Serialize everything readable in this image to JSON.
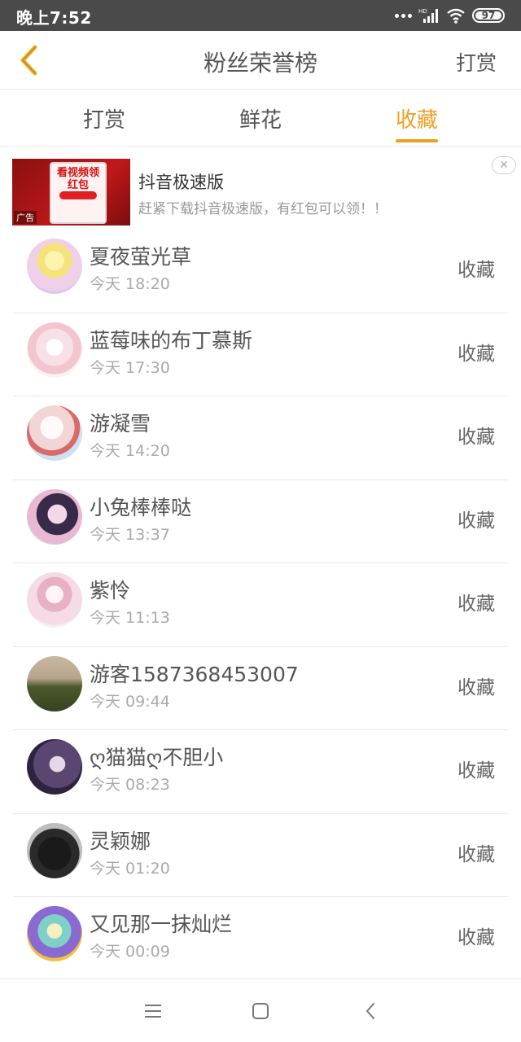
{
  "status_bar": {
    "time": "晚上7:52",
    "network": "HD",
    "battery": "97",
    "icons": [
      "more-dots-icon",
      "signal-icon",
      "wifi-icon",
      "battery-icon"
    ]
  },
  "header": {
    "back_icon": "chevron-left-icon",
    "title": "粉丝荣誉榜",
    "action_label": "打赏"
  },
  "tabs": [
    {
      "label": "打赏",
      "active": false
    },
    {
      "label": "鲜花",
      "active": false
    },
    {
      "label": "收藏",
      "active": true
    }
  ],
  "ad": {
    "title": "抖音极速版",
    "description": "赶紧下载抖音极速版，有红包可以领！！",
    "image_text": "看视频领红包",
    "badge": "广告",
    "close_icon": "close-icon"
  },
  "list": [
    {
      "name": "夏夜萤光草",
      "time": "今天 18:20",
      "action": "收藏"
    },
    {
      "name": "蓝莓味的布丁慕斯",
      "time": "今天 17:30",
      "action": "收藏"
    },
    {
      "name": "游凝雪",
      "time": "今天 14:20",
      "action": "收藏"
    },
    {
      "name": "小兔棒棒哒",
      "time": "今天 13:37",
      "action": "收藏"
    },
    {
      "name": "紫怜",
      "time": "今天 11:13",
      "action": "收藏"
    },
    {
      "name": "游客1587368453007",
      "time": "今天 09:44",
      "action": "收藏"
    },
    {
      "name": "ღ猫猫ღ不胆小",
      "time": "今天 08:23",
      "action": "收藏"
    },
    {
      "name": "灵颖娜",
      "time": "今天 01:20",
      "action": "收藏"
    },
    {
      "name": "又见那一抹灿烂",
      "time": "今天 00:09",
      "action": "收藏"
    }
  ],
  "nav_bar": {
    "icons": [
      "menu-icon",
      "home-square-icon",
      "back-arrow-icon"
    ]
  },
  "colors": {
    "accent": "#f0a020",
    "status_bar_bg": "#4a4a4a",
    "text_primary": "#555555",
    "text_secondary": "#aaaaaa"
  }
}
